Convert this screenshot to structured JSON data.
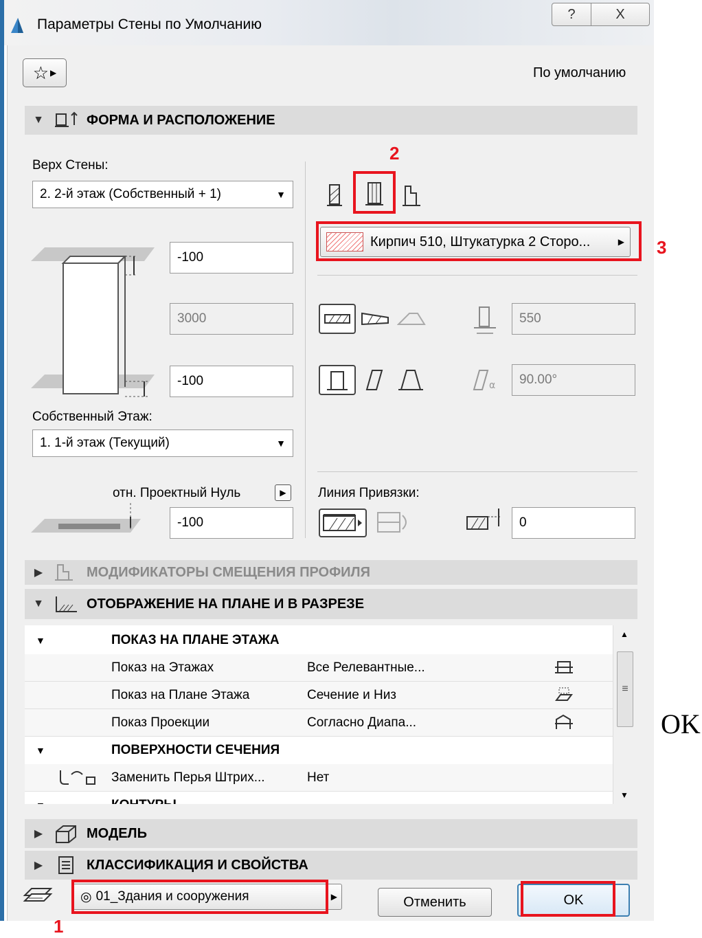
{
  "window": {
    "title": "Параметры Стены по Умолчанию",
    "help_glyph": "?",
    "close_glyph": "X"
  },
  "toolbar": {
    "favorites_icon": "star-icon",
    "default_label": "По умолчанию"
  },
  "sections": {
    "form": "ФОРМА И РАСПОЛОЖЕНИЕ",
    "profile_modifiers": "МОДИФИКАТОРЫ СМЕЩЕНИЯ ПРОФИЛЯ",
    "plan_display": "ОТОБРАЖЕНИЕ НА ПЛАНЕ И В РАЗРЕЗЕ",
    "model": "МОДЕЛЬ",
    "classification": "КЛАССИФИКАЦИЯ И СВОЙСТВА"
  },
  "form": {
    "top_label": "Верх Стены:",
    "top_value": "2. 2-й этаж (Собственный + 1)",
    "top_offset": "-100",
    "height": "3000",
    "bottom_offset": "-100",
    "home_story_label": "Собственный Этаж:",
    "home_story_value": "1. 1-й этаж (Текущий)",
    "project_zero_label": "отн. Проектный Нуль",
    "project_zero_value": "-100",
    "structure": "Кирпич 510, Штукатурка 2 Сторо...",
    "thickness": "550",
    "angle": "90.00°",
    "ref_line_label": "Линия Привязки:",
    "ref_offset": "0"
  },
  "plan_table": {
    "groups": [
      {
        "title": "ПОКАЗ НА ПЛАНЕ ЭТАЖА",
        "rows": [
          {
            "name": "Показ на Этажах",
            "value": "Все Релевантные..."
          },
          {
            "name": "Показ на Плане Этажа",
            "value": "Сечение и Низ"
          },
          {
            "name": "Показ Проекции",
            "value": "Согласно Диапа..."
          }
        ]
      },
      {
        "title": "ПОВЕРХНОСТИ СЕЧЕНИЯ",
        "rows": [
          {
            "name": "Заменить Перья Штрих...",
            "value": "Нет"
          }
        ]
      },
      {
        "title": "КОНТУРЫ",
        "rows": []
      }
    ]
  },
  "bottom": {
    "layer": "01_Здания и сооружения",
    "cancel": "Отменить",
    "ok": "OK"
  },
  "annotations": {
    "marker_1": "1",
    "marker_2": "2",
    "marker_3": "3",
    "outside_ok": "OK"
  },
  "colors": {
    "annotation_red": "#e8141e",
    "section_header_bg": "#dcdcdc",
    "dialog_bg": "#f0f0f0"
  }
}
